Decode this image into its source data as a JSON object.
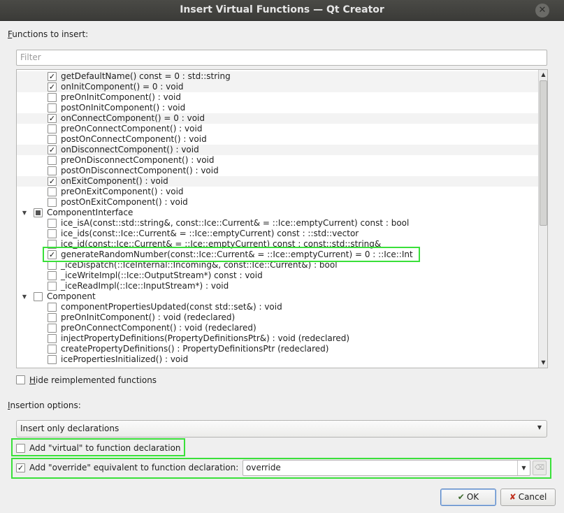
{
  "window": {
    "title": "Insert Virtual Functions — Qt Creator"
  },
  "functions_label": "Functions to insert:",
  "filter": {
    "placeholder": "Filter"
  },
  "tree": {
    "rows": [
      {
        "type": "func",
        "label": "getDefaultName() const = 0 : std::string",
        "checked": true,
        "alt": true
      },
      {
        "type": "func",
        "label": "onInitComponent() = 0 : void",
        "checked": true,
        "alt": true
      },
      {
        "type": "func",
        "label": "preOnInitComponent() : void",
        "checked": false,
        "alt": false
      },
      {
        "type": "func",
        "label": "postOnInitComponent() : void",
        "checked": false,
        "alt": false
      },
      {
        "type": "func",
        "label": "onConnectComponent() = 0 : void",
        "checked": true,
        "alt": true
      },
      {
        "type": "func",
        "label": "preOnConnectComponent() : void",
        "checked": false,
        "alt": false
      },
      {
        "type": "func",
        "label": "postOnConnectComponent() : void",
        "checked": false,
        "alt": false
      },
      {
        "type": "func",
        "label": "onDisconnectComponent() : void",
        "checked": true,
        "alt": true
      },
      {
        "type": "func",
        "label": "preOnDisconnectComponent() : void",
        "checked": false,
        "alt": false
      },
      {
        "type": "func",
        "label": "postOnDisconnectComponent() : void",
        "checked": false,
        "alt": false
      },
      {
        "type": "func",
        "label": "onExitComponent() : void",
        "checked": true,
        "alt": true
      },
      {
        "type": "func",
        "label": "preOnExitComponent() : void",
        "checked": false,
        "alt": false
      },
      {
        "type": "func",
        "label": "postOnExitComponent() : void",
        "checked": false,
        "alt": false
      },
      {
        "type": "class",
        "label": "ComponentInterface",
        "state": "partial"
      },
      {
        "type": "func",
        "label": "ice_isA(const::std::string&, const::Ice::Current& = ::Ice::emptyCurrent) const : bool",
        "checked": false,
        "alt": false
      },
      {
        "type": "func",
        "label": "ice_ids(const::Ice::Current& = ::Ice::emptyCurrent) const : ::std::vector",
        "checked": false,
        "alt": false
      },
      {
        "type": "func",
        "label": "ice_id(const::Ice::Current& = ::Ice::emptyCurrent) const : const::std::string&",
        "checked": false,
        "alt": false
      },
      {
        "type": "func",
        "label": "generateRandomNumber(const::Ice::Current& = ::Ice::emptyCurrent) = 0 : ::Ice::Int",
        "checked": true,
        "alt": false
      },
      {
        "type": "func",
        "label": "_iceDispatch(::IceInternal::Incoming&, const::Ice::Current&) : bool",
        "checked": false,
        "alt": false
      },
      {
        "type": "func",
        "label": "_iceWriteImpl(::Ice::OutputStream*) const : void",
        "checked": false,
        "alt": false
      },
      {
        "type": "func",
        "label": "_iceReadImpl(::Ice::InputStream*) : void",
        "checked": false,
        "alt": false
      },
      {
        "type": "class",
        "label": "Component",
        "state": "unchecked"
      },
      {
        "type": "func",
        "label": "componentPropertiesUpdated(const std::set&) : void",
        "checked": false,
        "alt": false
      },
      {
        "type": "func",
        "label": "preOnInitComponent() : void (redeclared)",
        "checked": false,
        "alt": false
      },
      {
        "type": "func",
        "label": "preOnConnectComponent() : void (redeclared)",
        "checked": false,
        "alt": false
      },
      {
        "type": "func",
        "label": "injectPropertyDefinitions(PropertyDefinitionsPtr&) : void (redeclared)",
        "checked": false,
        "alt": false
      },
      {
        "type": "func",
        "label": "createPropertyDefinitions() : PropertyDefinitionsPtr (redeclared)",
        "checked": false,
        "alt": false
      },
      {
        "type": "func",
        "label": "icePropertiesInitialized() : void",
        "checked": false,
        "alt": false
      }
    ]
  },
  "hide_reimplemented": {
    "label": "Hide reimplemented functions",
    "checked": false
  },
  "insertion_label": "Insertion options:",
  "insertion_combo": {
    "value": "Insert only declarations"
  },
  "add_virtual": {
    "label": "Add \"virtual\" to function declaration",
    "checked": false
  },
  "add_override": {
    "label": "Add \"override\" equivalent to function declaration:",
    "checked": true,
    "value": "override"
  },
  "buttons": {
    "ok": "OK",
    "cancel": "Cancel"
  },
  "colors": {
    "highlight": "#3ae03a",
    "titlebar": "#3c3b37"
  },
  "icons": {
    "ok": "ok-icon",
    "cancel": "cancel-icon",
    "close": "close-icon"
  }
}
